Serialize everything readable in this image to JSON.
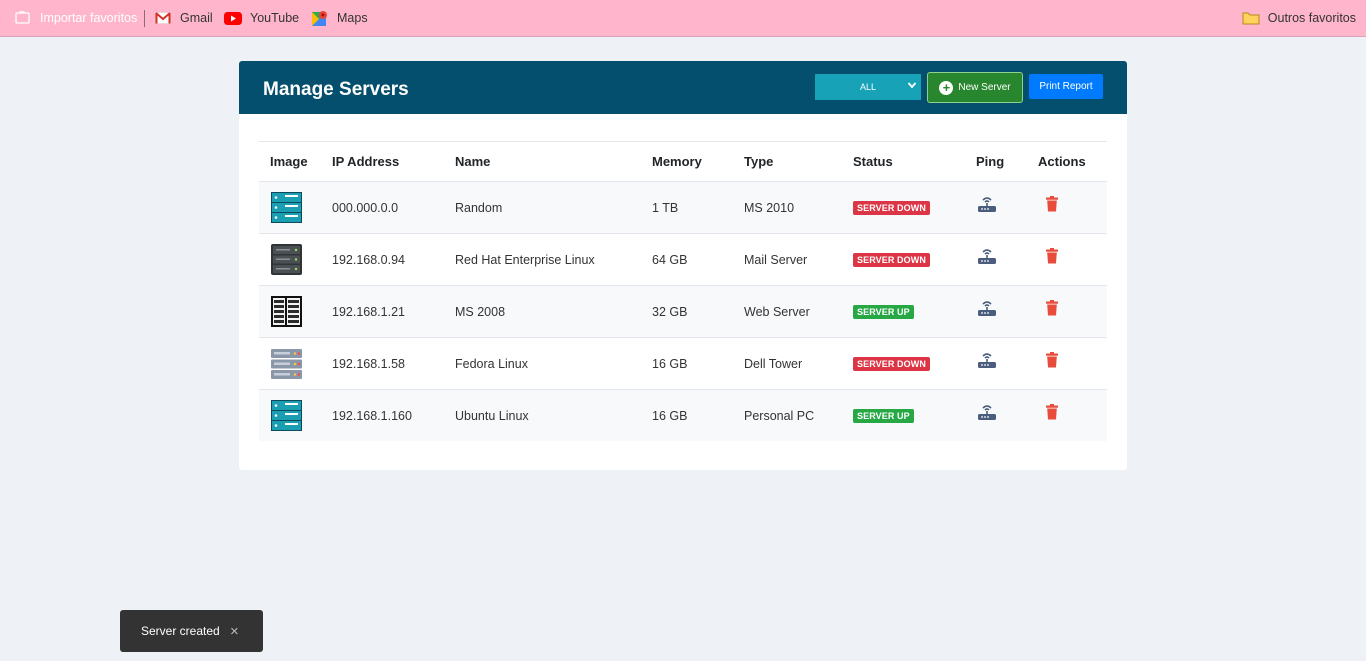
{
  "bookmarks": {
    "import_label": "Importar favoritos",
    "gmail_label": "Gmail",
    "youtube_label": "YouTube",
    "maps_label": "Maps",
    "other_label": "Outros favoritos"
  },
  "header": {
    "title": "Manage Servers",
    "filter_value": "ALL",
    "new_server_label": "New Server",
    "print_report_label": "Print Report"
  },
  "table": {
    "columns": [
      "Image",
      "IP Address",
      "Name",
      "Memory",
      "Type",
      "Status",
      "Ping",
      "Actions"
    ],
    "rows": [
      {
        "image_icon": "server-rack-icon",
        "ip": "000.000.0.0",
        "name": "Random",
        "memory": "1 TB",
        "type": "MS 2010",
        "status": "SERVER DOWN"
      },
      {
        "image_icon": "server-dark-icon",
        "ip": "192.168.0.94",
        "name": "Red Hat Enterprise Linux",
        "memory": "64 GB",
        "type": "Mail Server",
        "status": "SERVER DOWN"
      },
      {
        "image_icon": "server-cabinet-icon",
        "ip": "192.168.1.21",
        "name": "MS 2008",
        "memory": "32 GB",
        "type": "Web Server",
        "status": "SERVER UP"
      },
      {
        "image_icon": "server-grey-icon",
        "ip": "192.168.1.58",
        "name": "Fedora Linux",
        "memory": "16 GB",
        "type": "Dell Tower",
        "status": "SERVER DOWN"
      },
      {
        "image_icon": "server-rack-icon",
        "ip": "192.168.1.160",
        "name": "Ubuntu Linux",
        "memory": "16 GB",
        "type": "Personal PC",
        "status": "SERVER UP"
      }
    ]
  },
  "toast": {
    "message": "Server created",
    "close_glyph": "×"
  },
  "colors": {
    "header_bg": "#054f6e",
    "status_down": "#dc3545",
    "status_up": "#28a745",
    "delete_icon": "#e74c3c",
    "bookmark_bar": "#ffb6cd"
  }
}
